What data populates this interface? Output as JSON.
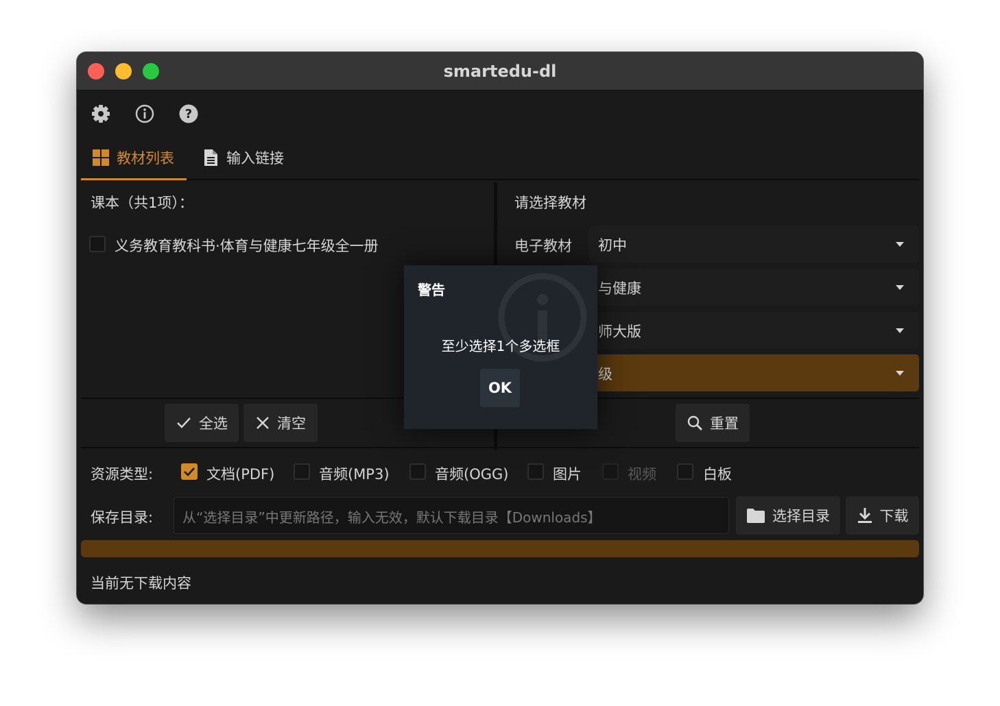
{
  "window": {
    "title": "smartedu-dl"
  },
  "toolbar": {
    "icons": [
      "gear-icon",
      "info-icon",
      "help-icon"
    ]
  },
  "tabs": [
    {
      "label": "教材列表",
      "icon": "grid-icon",
      "active": true
    },
    {
      "label": "输入链接",
      "icon": "document-icon",
      "active": false
    }
  ],
  "left_panel": {
    "header": "课本（共1项）：",
    "items": [
      {
        "label": "义务教育教科书·体育与健康七年级全一册",
        "checked": false
      }
    ]
  },
  "right_panel": {
    "header": "请选择教材",
    "category_label": "电子教材",
    "selects": [
      {
        "value": "初中",
        "active": false
      },
      {
        "value": "与健康",
        "active": false
      },
      {
        "value": "师大版",
        "active": false
      },
      {
        "value": "级",
        "active": true
      }
    ]
  },
  "actions": {
    "select_all": "全选",
    "clear": "清空",
    "reset": "重置"
  },
  "resource_types": {
    "label": "资源类型:",
    "options": [
      {
        "label": "文档(PDF)",
        "checked": true,
        "disabled": false
      },
      {
        "label": "音频(MP3)",
        "checked": false,
        "disabled": false
      },
      {
        "label": "音频(OGG)",
        "checked": false,
        "disabled": false
      },
      {
        "label": "图片",
        "checked": false,
        "disabled": false
      },
      {
        "label": "视频",
        "checked": false,
        "disabled": true
      },
      {
        "label": "白板",
        "checked": false,
        "disabled": false
      }
    ]
  },
  "save": {
    "label": "保存目录:",
    "placeholder": "从“选择目录”中更新路径，输入无效，默认下载目录【Downloads】",
    "choose_dir": "选择目录",
    "download": "下载"
  },
  "progress": {
    "fraction": 0.0
  },
  "status": "当前无下载内容",
  "dialog": {
    "title": "警告",
    "message": "至少选择1个多选框",
    "ok": "OK"
  },
  "colors": {
    "accent": "#d28a26",
    "accent_dark": "#5a3a0e",
    "background": "#1a1a1a"
  }
}
